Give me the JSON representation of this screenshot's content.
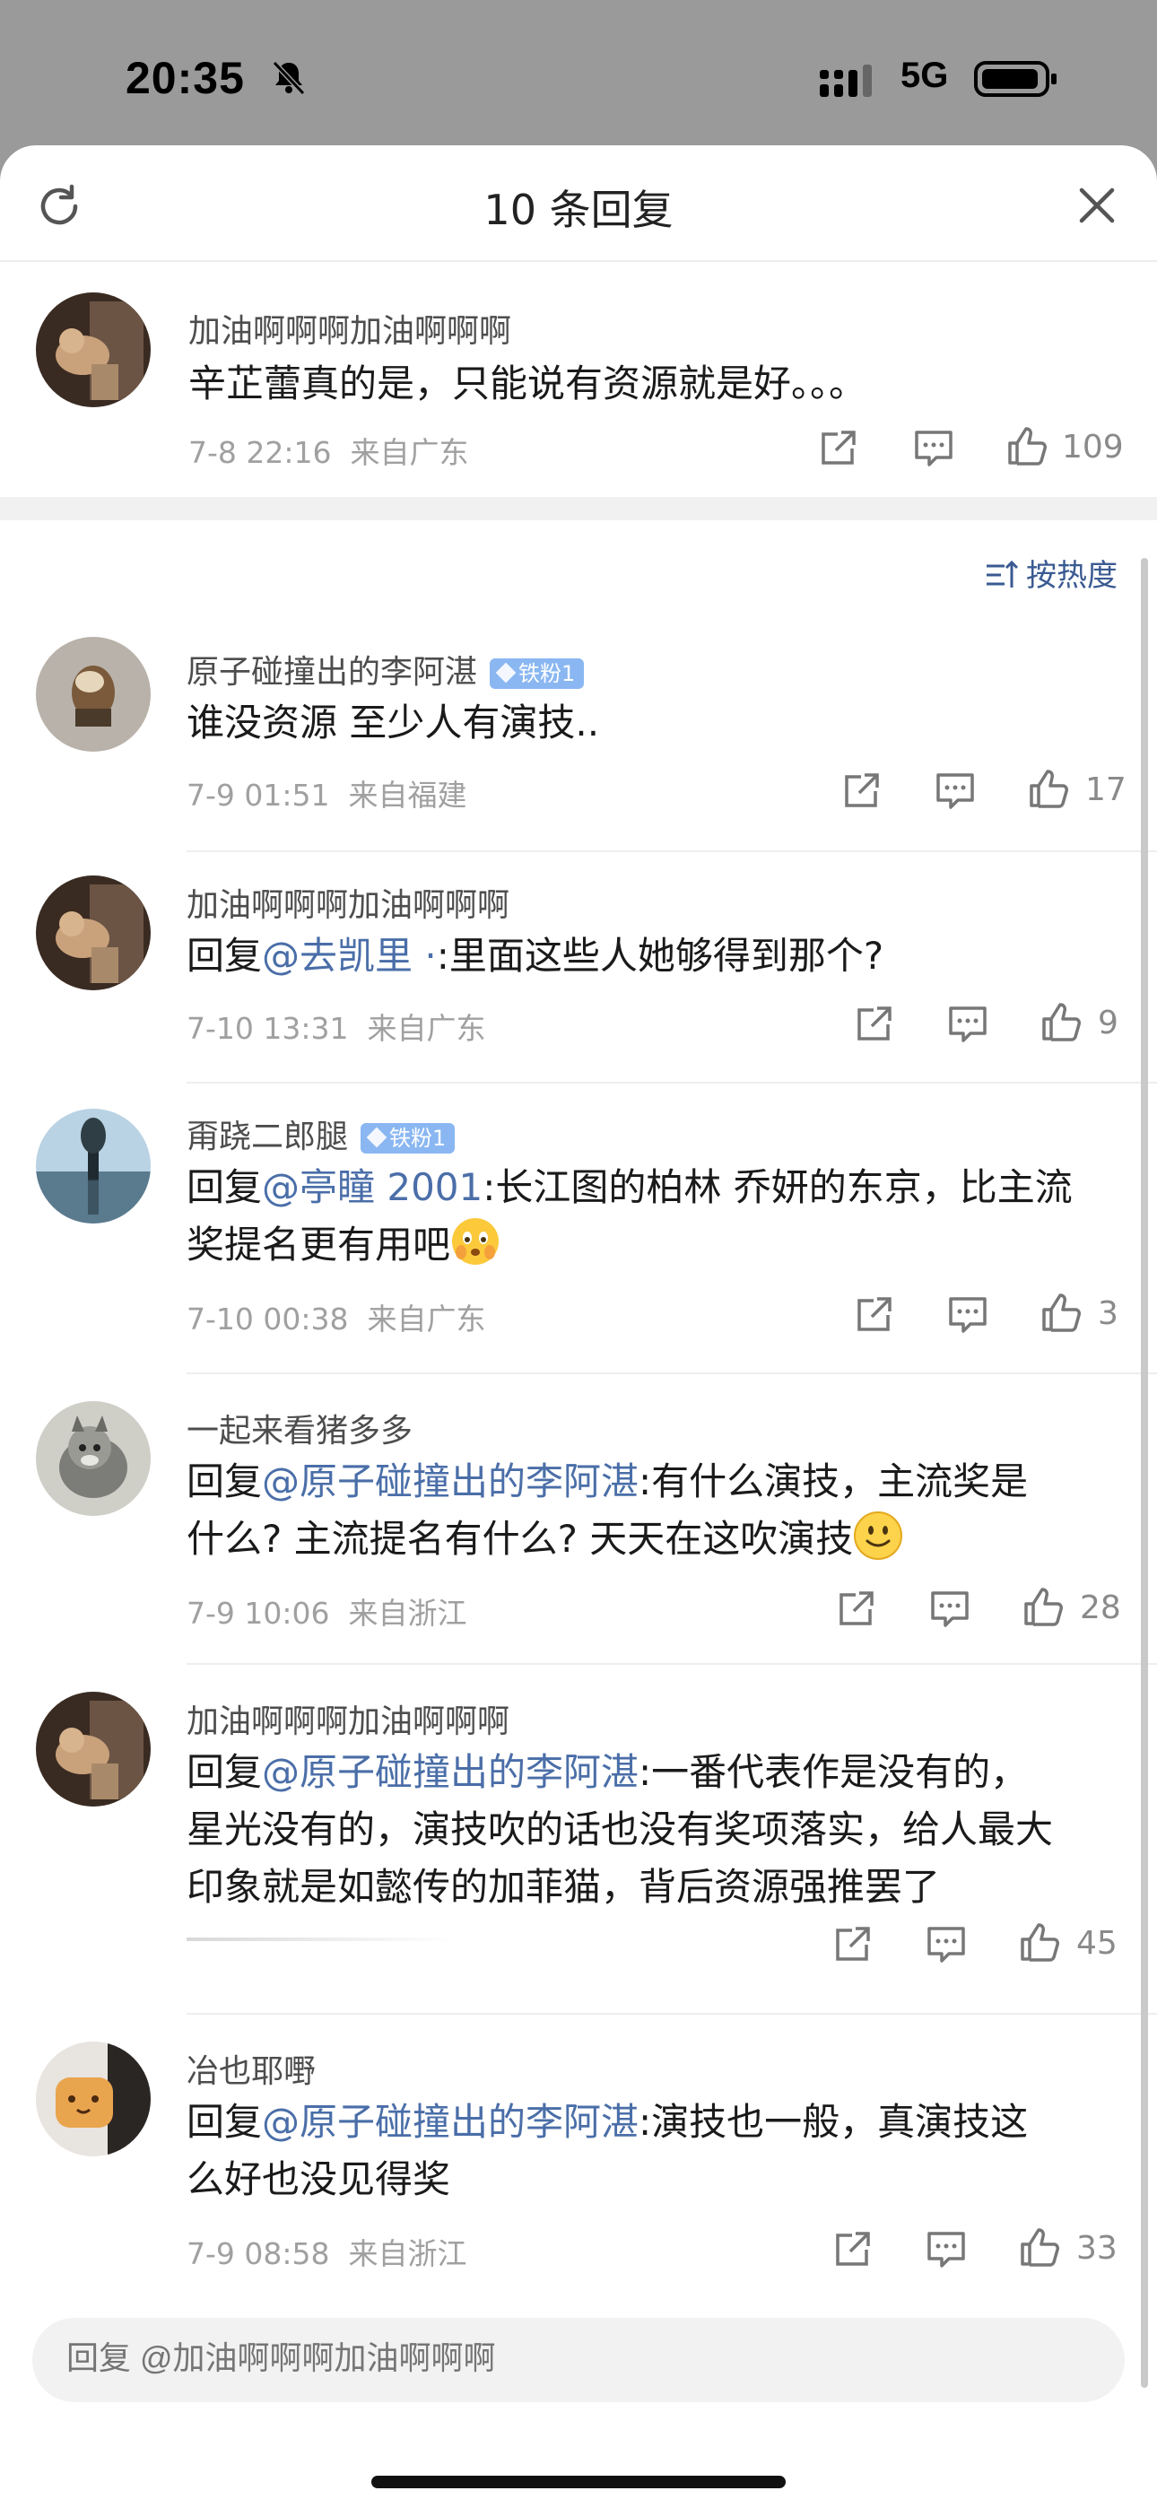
{
  "status": {
    "time": "20:35",
    "network": "5G"
  },
  "header": {
    "title": "10 条回复"
  },
  "root": {
    "username": "加油啊啊啊加油啊啊啊",
    "text": "辛芷蕾真的是，只能说有资源就是好。。。",
    "date": "7-8 22:16",
    "location": "来自广东",
    "likes": "109"
  },
  "sort": {
    "label": "按热度"
  },
  "comments": [
    {
      "username": "原子碰撞出的李阿湛",
      "badge": "铁粉1",
      "line1": "谁没资源 至少人有演技..",
      "date": "7-9 01:51",
      "location": "来自福建",
      "likes": "17"
    },
    {
      "username": "加油啊啊啊加油啊啊啊",
      "reply_prefix": "回复",
      "mention": "@去凯里 ·",
      "line1": ":里面这些人她够得到那个?",
      "date": "7-10 13:31",
      "location": "来自广东",
      "likes": "9"
    },
    {
      "username": "甭跷二郎腿",
      "badge": "铁粉1",
      "reply_prefix": "回复",
      "mention": "@亭瞳 2001",
      "line1": ":长江图的柏林 乔妍的东京，比主流",
      "line2": "奖提名更有用吧",
      "date": "7-10 00:38",
      "location": "来自广东",
      "likes": "3"
    },
    {
      "username": "一起来看猪多多",
      "reply_prefix": "回复",
      "mention": "@原子碰撞出的李阿湛",
      "line1": ":有什么演技，主流奖是",
      "line2": "什么? 主流提名有什么? 天天在这吹演技",
      "date": "7-9 10:06",
      "location": "来自浙江",
      "likes": "28"
    },
    {
      "username": "加油啊啊啊加油啊啊啊",
      "reply_prefix": "回复",
      "mention": "@原子碰撞出的李阿湛",
      "line1": ":一番代表作是没有的，",
      "line2": "星光没有的，演技吹的话也没有奖项落实，给人最大",
      "line3": "印象就是如懿传的加菲猫，背后资源强推罢了",
      "likes": "45"
    },
    {
      "username": "冶也耶嘢",
      "reply_prefix": "回复",
      "mention": "@原子碰撞出的李阿湛",
      "line1": ":演技也一般，真演技这",
      "line2": "么好也没见得奖",
      "date": "7-9 08:58",
      "location": "来自浙江",
      "likes": "33"
    }
  ],
  "reply": {
    "placeholder": "回复 @加油啊啊啊加油啊啊啊"
  }
}
